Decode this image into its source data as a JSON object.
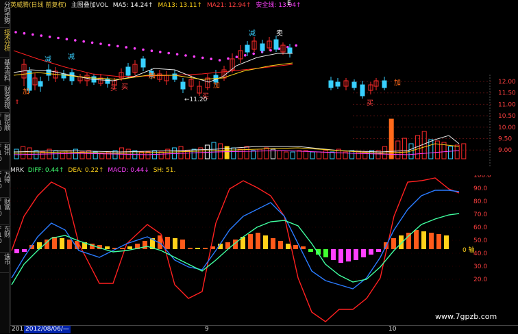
{
  "sidebar": {
    "tabs": [
      "分时走势",
      "技术分析",
      "基本资料",
      "财务透视",
      "同花顺F10",
      "和讯F10",
      "万得F10",
      "财富F10",
      "东财F10",
      "诛币"
    ],
    "active_index": 1
  },
  "header": {
    "stock_name": "英威腾(日线 前复权)",
    "overlay_label": "主图叠加VOL",
    "ma5_label": "MA5: 14.24↑",
    "ma13_label": "MA13: 13.11↑",
    "ma21_label": "MA21: 12.94↑",
    "safety_label": "安全线: 13.04↑",
    "corner_label": "E"
  },
  "annotations": {
    "low_price": "←11.20",
    "signals": {
      "jian": "减",
      "jia": "加",
      "mai": "买",
      "mai_sell": "卖",
      "tuo": "托"
    }
  },
  "right_axis_main": [
    "12.00",
    "11.50",
    "11.00",
    "10.50",
    "10.00",
    "9.50",
    "9.00"
  ],
  "indicator": {
    "name": "MRK",
    "diff_label": "DIFF: 0.44↑",
    "dea_label": "DEA: 0.22↑",
    "macd_label": "MACD: 0.44↓",
    "sh_label": "SH: 51.",
    "zero_axis_label": "0 轴",
    "right_axis": [
      "100.0",
      "90.0",
      "80.0",
      "70.0",
      "60.0",
      "50.0",
      "40.0",
      "30.0",
      "20.0"
    ]
  },
  "bottom": {
    "left_cell": "201",
    "date_label": "2012/08/06/—",
    "marker_9": "9",
    "marker_10": "10",
    "watermark": "www.7gpzb.com"
  },
  "colors": {
    "red": "#ff2020",
    "blue": "#2a7bff",
    "green": "#40ffa0",
    "yellow": "#ffd21a",
    "orange": "#ff6a1a",
    "magenta": "#ff40ff",
    "cyan": "#38d0ff",
    "white": "#ffffff"
  }
}
